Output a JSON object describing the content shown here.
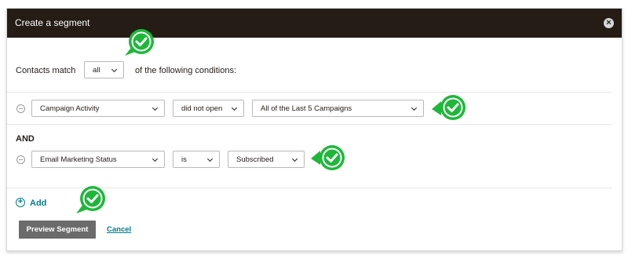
{
  "dialog": {
    "title": "Create a segment",
    "close_glyph": "×"
  },
  "match": {
    "prefix": "Contacts match",
    "selected": "all",
    "suffix": "of the following conditions:"
  },
  "conditions": [
    {
      "field": "Campaign Activity",
      "operator": "did not open",
      "value": "All of the Last 5 Campaigns"
    },
    {
      "field": "Email Marketing Status",
      "operator": "is",
      "value": "Subscribed"
    }
  ],
  "joiner": "AND",
  "add": {
    "label": "Add",
    "icon": "+"
  },
  "actions": {
    "preview_label": "Preview Segment",
    "cancel_label": "Cancel"
  },
  "colors": {
    "titlebar": "#241c15",
    "link": "#007c89",
    "check_badge": "#1db83a",
    "preview_button": "#6b6b6b"
  }
}
